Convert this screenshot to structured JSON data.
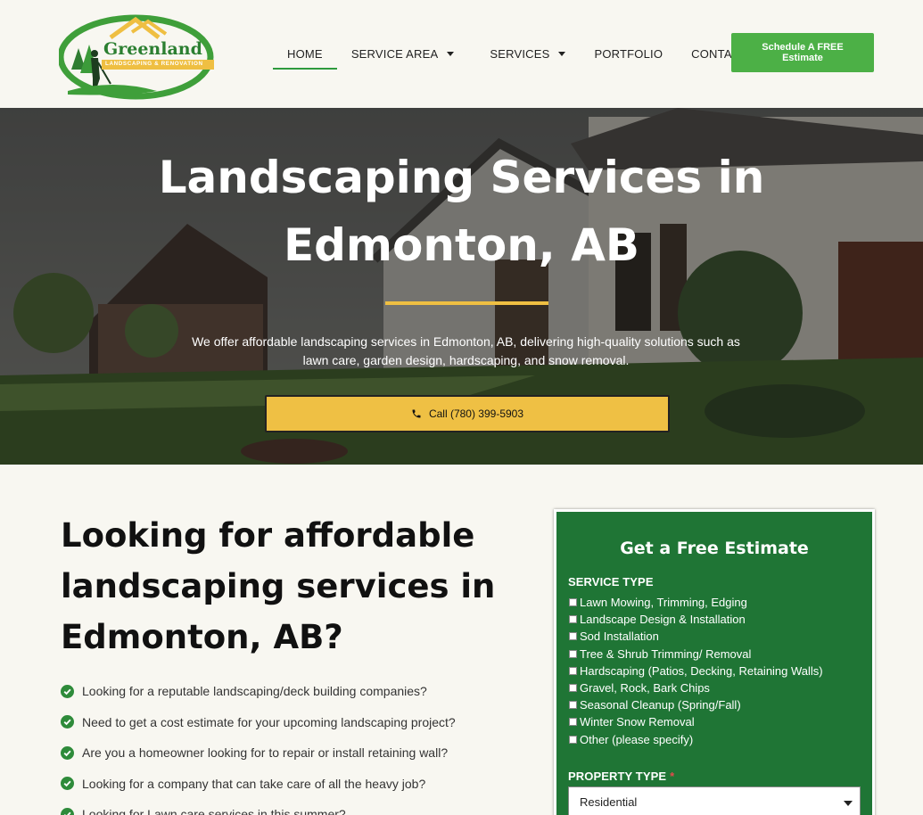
{
  "brand": {
    "name": "Greenland",
    "tagline": "LANDSCAPING & RENOVATION"
  },
  "nav": {
    "items": [
      {
        "label": "HOME"
      },
      {
        "label": "SERVICE AREA"
      },
      {
        "label": "SERVICES"
      },
      {
        "label": "PORTFOLIO"
      },
      {
        "label": "CONTACT"
      }
    ],
    "cta_line1": "Schedule A FREE",
    "cta_line2": "Estimate"
  },
  "hero": {
    "title_line1": "Landscaping Services in",
    "title_line2": "Edmonton, AB",
    "subtitle_line1": "We offer affordable landscaping services in Edmonton, AB, delivering high-quality solutions such as",
    "subtitle_line2": "lawn care, garden design, hardscaping, and snow removal.",
    "call_label": "Call (780) 399-5903"
  },
  "main": {
    "title_line1": "Looking for affordable",
    "title_line2": "landscaping services in",
    "title_line3": "Edmonton, AB?",
    "checklist": [
      "Looking for a reputable landscaping/deck building companies?",
      "Need to get a cost estimate for your upcoming landscaping project?",
      "Are you a homeowner looking for to repair or install retaining wall?",
      "Looking for a company that can take care of all the heavy job?",
      "Looking for Lawn care services in this summer?"
    ]
  },
  "form": {
    "title": "Get a Free Estimate",
    "service_type_label": "SERVICE TYPE",
    "service_options": [
      "Lawn Mowing, Trimming, Edging",
      "Landscape Design & Installation",
      "Sod Installation",
      "Tree & Shrub Trimming/ Removal",
      "Hardscaping (Patios, Decking, Retaining Walls)",
      "Gravel, Rock, Bark Chips",
      "Seasonal Cleanup (Spring/Fall)",
      "Winter Snow Removal",
      "Other (please specify)"
    ],
    "property_type_label": "PROPERTY TYPE",
    "property_required_mark": "*",
    "property_selected": "Residential"
  },
  "colors": {
    "accent_green": "#4cb046",
    "form_green": "#1f7535",
    "accent_yellow": "#efc044",
    "page_bg": "#f8f7f1"
  }
}
